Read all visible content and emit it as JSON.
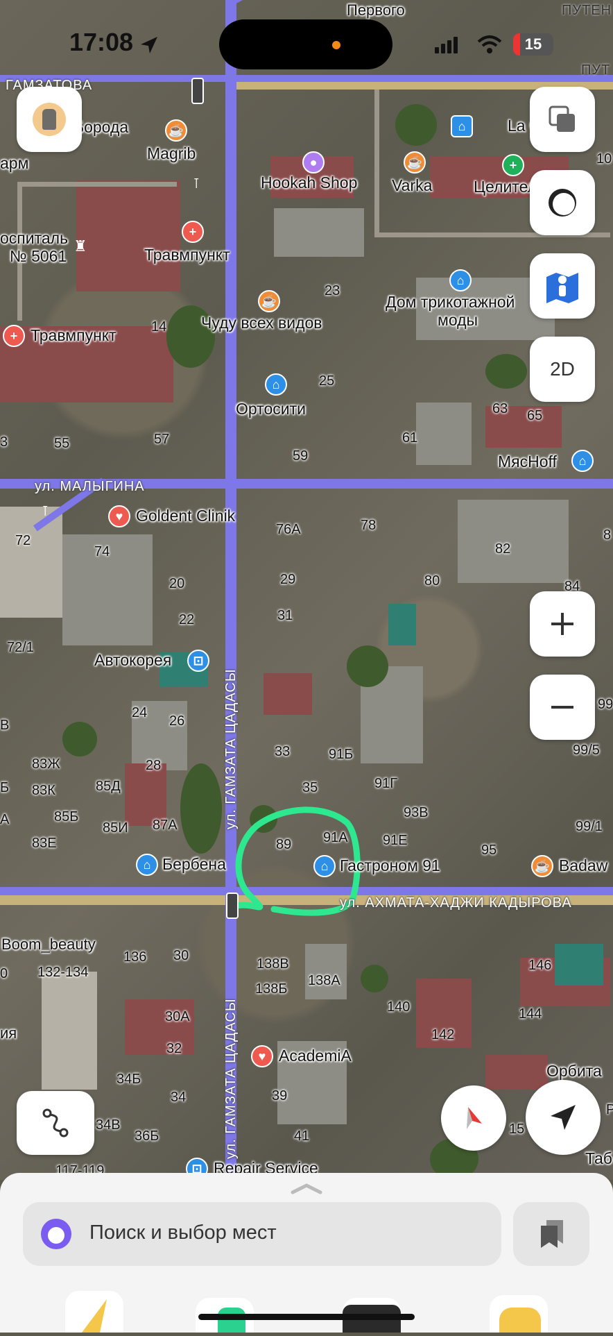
{
  "status_bar": {
    "time": "17:08",
    "battery": "15"
  },
  "map": {
    "watermark": "",
    "streets": {
      "gamzatova": "ГАМЗАТОВА",
      "malygina": "ул. МАЛЫГИНА",
      "gamzata_1": "ул. ГАМЗАТА ЦАДАСЫ",
      "gamzata_2": "ул. ГАМЗАТА ЦАДАСЫ",
      "kadyrova": "ул. АХМАТА-ХАДЖИ КАДЫРОВА",
      "pervogo": "Первого",
      "puten": "ПУТЕН",
      "put": "ПУТ"
    },
    "places": {
      "boroda": "Борода",
      "magrib": "Magrib",
      "hookah": "Hookah Shop",
      "varka": "Varka",
      "celitel": "Целител",
      "lac": "La C",
      "arm": "арм",
      "hospital": "оспиталь",
      "hospital_no": "№ 5061",
      "travm1": "Травмпункт",
      "travm2": "Травмпункт",
      "chudu": "Чуду всех видов",
      "dom_trik": "Дом трикотажной",
      "mody": "моды",
      "ortositi": "Ортосити",
      "myasoff": "МясHoff",
      "goldent": "Goldent Clinik",
      "avtokoreya": "Автокорея",
      "berbena": "Бербена",
      "gastronom": "Гастроном 91",
      "badaw": "Badaw",
      "boom": "Boom_beauty",
      "academia": "AcademiA",
      "orbita": "Орбита",
      "repair": "Repair Service",
      "tab": "Таб",
      "ya": "ия"
    },
    "numbers": [
      "23",
      "14",
      "25",
      "63",
      "65",
      "61",
      "55",
      "57",
      "59",
      "76А",
      "78",
      "82",
      "72",
      "74",
      "29",
      "80",
      "84",
      "20",
      "31",
      "22",
      "72/1",
      "99",
      "24",
      "26",
      "99/5",
      "83Ж",
      "28",
      "33",
      "91Б",
      "35",
      "91Г",
      "83К",
      "85Д",
      "85Б",
      "93В",
      "99/1",
      "85И",
      "87А",
      "83Е",
      "89",
      "91А",
      "91Е",
      "95",
      "132-134",
      "136",
      "30",
      "138В",
      "138Б",
      "138А",
      "146",
      "140",
      "144",
      "142",
      "30А",
      "32",
      "34Б",
      "34",
      "34В",
      "39",
      "36Б",
      "41",
      "117-119",
      "10",
      "15",
      "8",
      "В",
      "Б",
      "А",
      "0",
      "3",
      "Р"
    ]
  },
  "controls": {
    "twod": "2D"
  },
  "search": {
    "placeholder": "Поиск и выбор мест"
  },
  "colors": {
    "route": "#7d77e8",
    "annotation": "#2ee88f",
    "accent": "#7a5cf0"
  }
}
